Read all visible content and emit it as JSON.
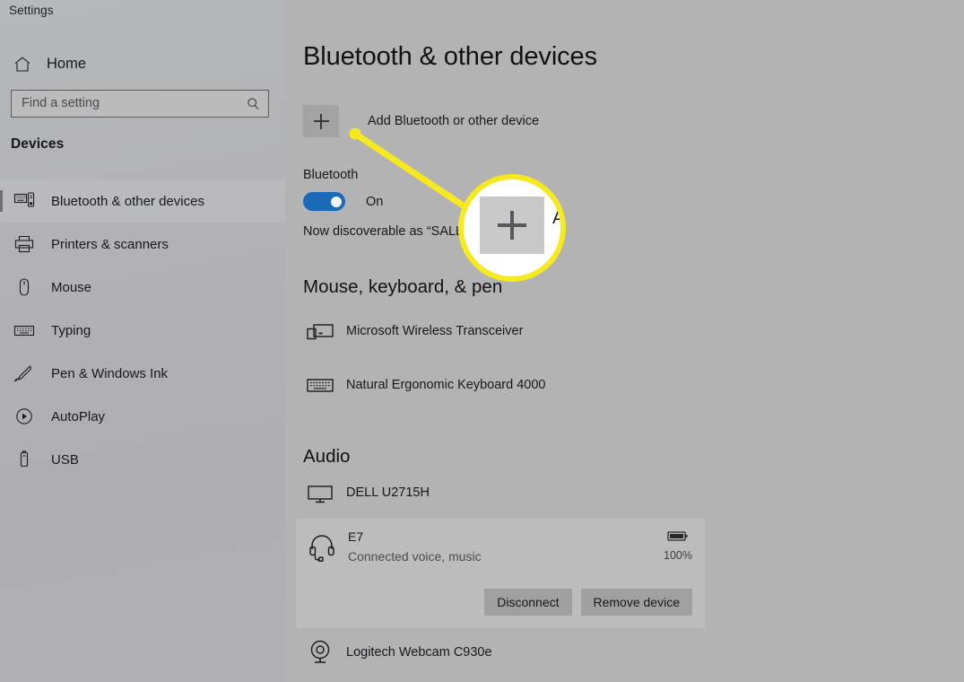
{
  "window": {
    "title": "Settings"
  },
  "sidebar": {
    "home": {
      "label": "Home",
      "icon": "home-icon"
    },
    "search": {
      "placeholder": "Find a setting",
      "value": "",
      "icon": "search-icon"
    },
    "category": "Devices",
    "items": [
      {
        "label": "Bluetooth & other devices",
        "icon": "bluetooth-devices-icon",
        "selected": true
      },
      {
        "label": "Printers & scanners",
        "icon": "printer-icon",
        "selected": false
      },
      {
        "label": "Mouse",
        "icon": "mouse-icon",
        "selected": false
      },
      {
        "label": "Typing",
        "icon": "keyboard-icon",
        "selected": false
      },
      {
        "label": "Pen & Windows Ink",
        "icon": "pen-icon",
        "selected": false
      },
      {
        "label": "AutoPlay",
        "icon": "autoplay-icon",
        "selected": false
      },
      {
        "label": "USB",
        "icon": "usb-icon",
        "selected": false
      }
    ]
  },
  "main": {
    "title": "Bluetooth & other devices",
    "add_device": {
      "label": "Add Bluetooth or other device",
      "icon": "plus-icon"
    },
    "bluetooth": {
      "label": "Bluetooth",
      "state": "On",
      "enabled": true,
      "discoverable_text": "Now discoverable as “SALLY”"
    },
    "sections": [
      {
        "heading": "Mouse, keyboard, & pen",
        "devices": [
          {
            "name": "Microsoft Wireless Transceiver",
            "icon": "wireless-transceiver-icon"
          },
          {
            "name": "Natural Ergonomic Keyboard 4000",
            "icon": "keyboard-icon"
          }
        ]
      },
      {
        "heading": "Audio",
        "devices": [
          {
            "name": "DELL U2715H",
            "icon": "monitor-icon"
          },
          {
            "name": "Logitech Webcam C930e",
            "icon": "webcam-icon"
          }
        ]
      }
    ],
    "selected_device": {
      "name": "E7",
      "status": "Connected voice, music",
      "icon": "headset-icon",
      "battery": "100%",
      "battery_icon": "battery-full-icon",
      "buttons": [
        {
          "label": "Disconnect"
        },
        {
          "label": "Remove device"
        }
      ]
    }
  },
  "callout": {
    "highlight_color": "#f7e920",
    "magnified_icon": "plus-icon",
    "magnified_letter": "A"
  }
}
